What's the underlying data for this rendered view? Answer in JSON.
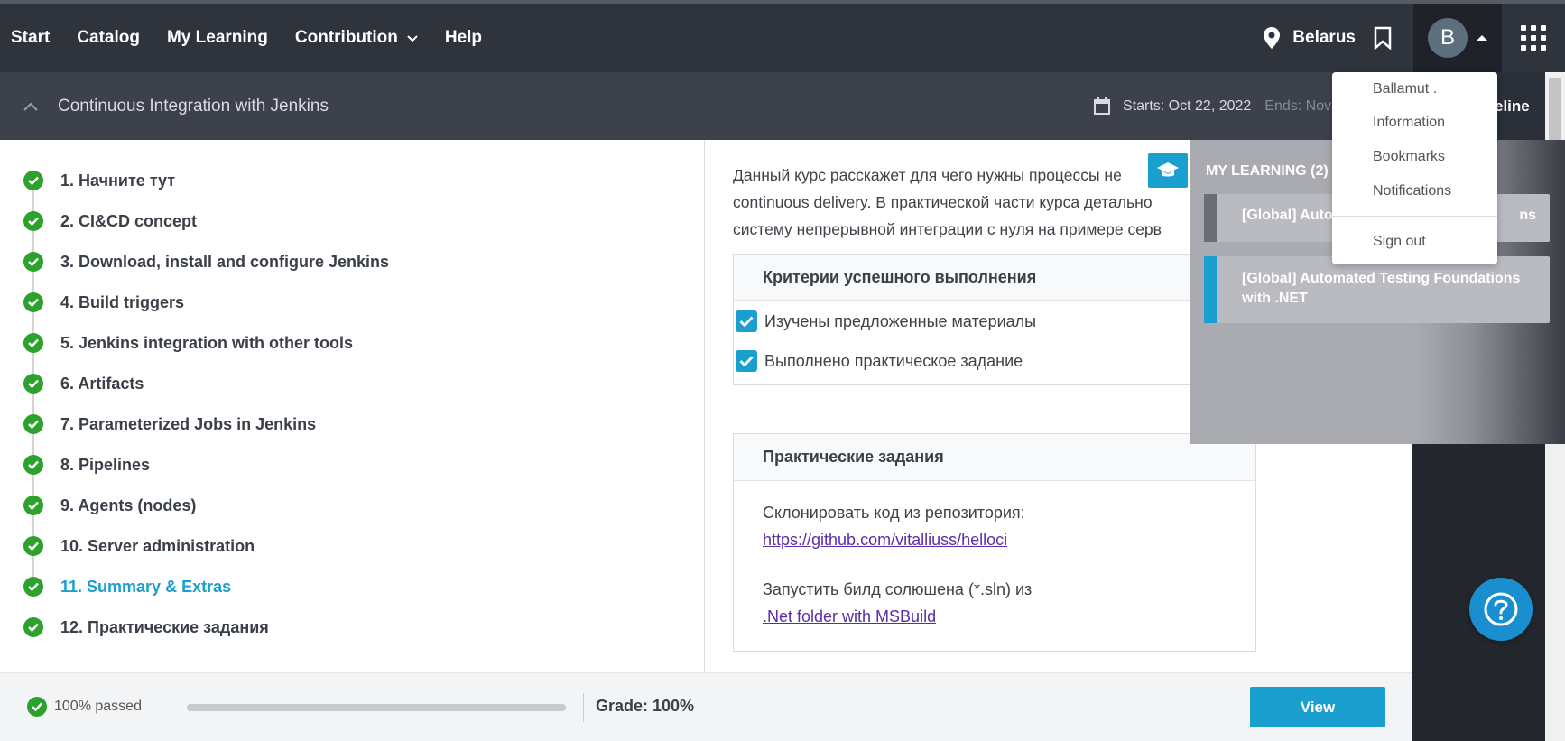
{
  "nav": {
    "links": [
      "Start",
      "Catalog",
      "My Learning",
      "Contribution",
      "Help"
    ],
    "location": "Belarus",
    "avatar_letter": "B"
  },
  "course": {
    "title": "Continuous Integration with Jenkins",
    "starts": "Starts: Oct 22, 2022",
    "ends": "Ends: Nov",
    "timeline_label": "eline"
  },
  "toc": [
    "1. Начните тут",
    "2. CI&CD concept",
    "3. Download, install and configure Jenkins",
    "4. Build triggers",
    "5. Jenkins integration with other tools",
    "6. Artifacts",
    "7. Parameterized Jobs in Jenkins",
    "8. Pipelines",
    "9. Agents (nodes)",
    "10. Server administration",
    "11. Summary & Extras",
    "12. Практические задания"
  ],
  "content": {
    "intro_line1": " Данный курс расскажет для чего нужны процессы не",
    "intro_line2": "continuous delivery. В практической части курса детально",
    "intro_line3": "систему непрерывной интеграции с нуля на примере серв",
    "criteria_title": "Критерии успешного выполнения",
    "criteria": [
      "Изучены предложенные материалы",
      "Выполнено практическое задание"
    ],
    "tasks_title": "Практические задания",
    "task1_text": "Склонировать код из репозитория:",
    "task1_link": "https://github.com/vitalliuss/helloci",
    "task2_text": "Запустить билд солюшена (*.sln) из",
    "task2_link": ".Net folder with MSBuild"
  },
  "footer": {
    "passed": "100% passed",
    "progress_percent": 100,
    "grade": "Grade: 100%",
    "view_button": "View"
  },
  "my_learning": {
    "title": "MY LEARNING (2)",
    "card1_left": "[Global] Autom",
    "card1_right": "ns",
    "card2": "[Global] Automated Testing Foundations with .NET",
    "card1_color": "#6b6d73",
    "card2_color": "#1a9fcf"
  },
  "user_menu": {
    "items": [
      "Ballamut .",
      "Information",
      "Bookmarks",
      "Notifications"
    ],
    "sign_out": "Sign out"
  },
  "colors": {
    "accent": "#1a9fcf",
    "success": "#2ca12c",
    "nav_bg": "#2f333c"
  }
}
